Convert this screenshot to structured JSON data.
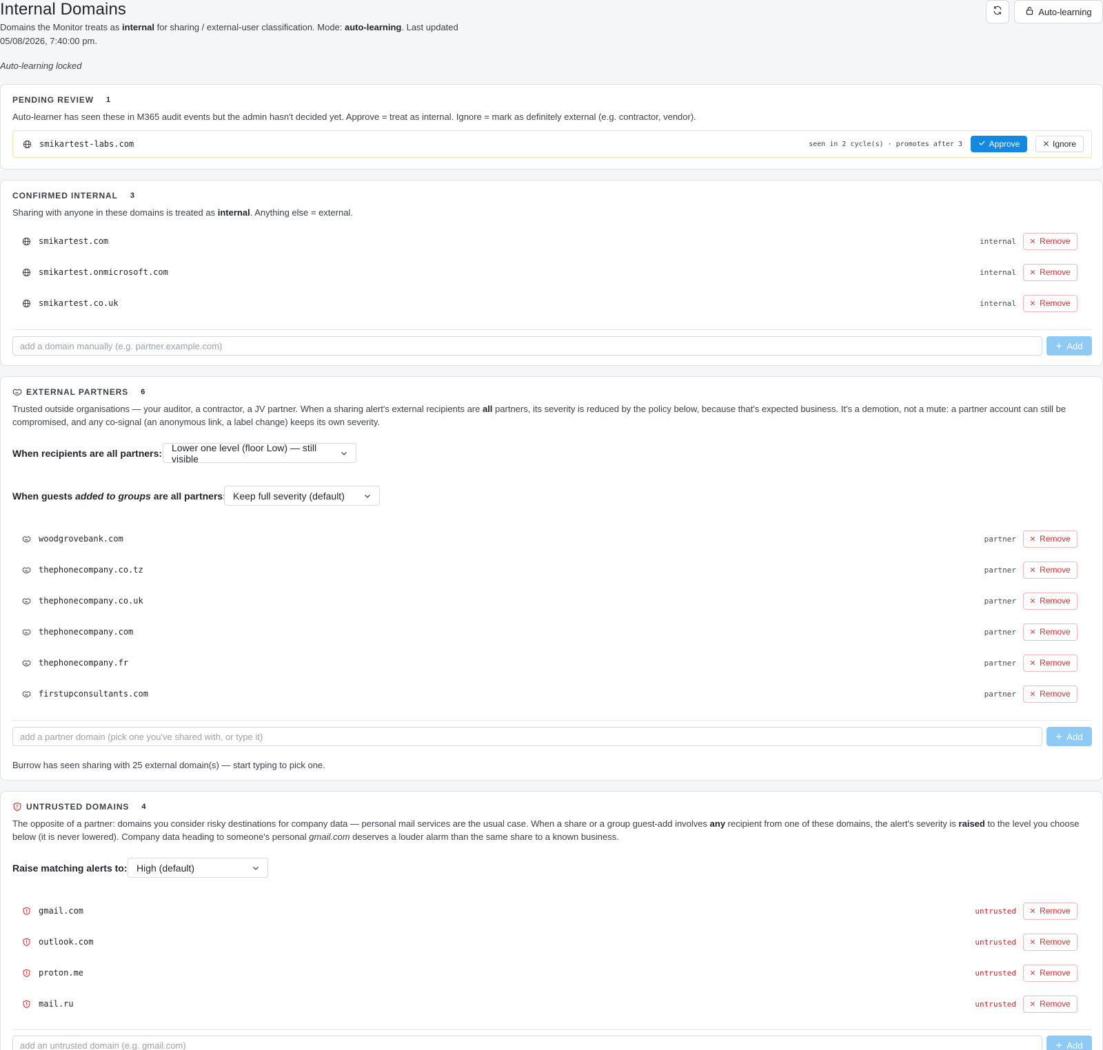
{
  "header": {
    "title": "Internal Domains",
    "subtitle_pre": "Domains the Monitor treats as ",
    "subtitle_bold1": "internal",
    "subtitle_mid": " for sharing / external-user classification. Mode: ",
    "subtitle_bold2": "auto-learning",
    "subtitle_post": ". Last updated 05/08/2026, 7:40:00 pm.",
    "locked_note": "Auto-learning locked",
    "auto_learning_label": "Auto-learning"
  },
  "pending": {
    "heading": "PENDING REVIEW",
    "count": "1",
    "description": "Auto-learner has seen these in M365 audit events but the admin hasn't decided yet. Approve = treat as internal. Ignore = mark as definitely external (e.g. contractor, vendor).",
    "items": [
      {
        "domain": "smikartest-labs.com",
        "meta": "seen in 2 cycle(s) · promotes after 3"
      }
    ],
    "approve_label": "Approve",
    "ignore_label": "Ignore"
  },
  "confirmed": {
    "heading": "CONFIRMED INTERNAL",
    "count": "3",
    "desc_pre": "Sharing with anyone in these domains is treated as ",
    "desc_bold": "internal",
    "desc_post": ". Anything else = external.",
    "items": [
      {
        "domain": "smikartest.com",
        "tag": "internal"
      },
      {
        "domain": "smikartest.onmicrosoft.com",
        "tag": "internal"
      },
      {
        "domain": "smikartest.co.uk",
        "tag": "internal"
      }
    ],
    "remove_label": "Remove",
    "add_placeholder": "add a domain manually (e.g. partner.example.com)",
    "add_label": "Add"
  },
  "partners": {
    "heading": "EXTERNAL PARTNERS",
    "count": "6",
    "desc_pre": "Trusted outside organisations — your auditor, a contractor, a JV partner. When a sharing alert's external recipients are ",
    "desc_bold": "all",
    "desc_post": " partners, its severity is reduced by the policy below, because that's expected business. It's a demotion, not a mute: a partner account can still be compromised, and any co-signal (an anonymous link, a label change) keeps its own severity.",
    "recipients_label": "When recipients are all partners:",
    "recipients_value": "Lower one level (floor Low) — still visible",
    "groups_label_pre": "When guests",
    "groups_label_em": "added to groups",
    "groups_label_post": "are all partners:",
    "groups_value": "Keep full severity (default)",
    "items": [
      {
        "domain": "woodgrovebank.com",
        "tag": "partner"
      },
      {
        "domain": "thephonecompany.co.tz",
        "tag": "partner"
      },
      {
        "domain": "thephonecompany.co.uk",
        "tag": "partner"
      },
      {
        "domain": "thephonecompany.com",
        "tag": "partner"
      },
      {
        "domain": "thephonecompany.fr",
        "tag": "partner"
      },
      {
        "domain": "firstupconsultants.com",
        "tag": "partner"
      }
    ],
    "remove_label": "Remove",
    "add_placeholder": "add a partner domain (pick one you've shared with, or type it)",
    "add_label": "Add",
    "footnote": "Burrow has seen sharing with 25 external domain(s) — start typing to pick one."
  },
  "untrusted": {
    "heading": "UNTRUSTED DOMAINS",
    "count": "4",
    "desc_pre": "The opposite of a partner: domains you consider risky destinations for company data — personal mail services are the usual case. When a share or a group guest-add involves ",
    "desc_bold1": "any",
    "desc_mid": " recipient from one of these domains, the alert's severity is ",
    "desc_bold2": "raised",
    "desc_mid2": " to the level you choose below (it is never lowered). Company data heading to someone's personal ",
    "desc_em": "gmail.com",
    "desc_post": " deserves a louder alarm than the same share to a known business.",
    "raise_label": "Raise matching alerts to:",
    "raise_value": "High (default)",
    "items": [
      {
        "domain": "gmail.com",
        "tag": "untrusted"
      },
      {
        "domain": "outlook.com",
        "tag": "untrusted"
      },
      {
        "domain": "proton.me",
        "tag": "untrusted"
      },
      {
        "domain": "mail.ru",
        "tag": "untrusted"
      }
    ],
    "remove_label": "Remove",
    "add_placeholder": "add an untrusted domain (e.g. gmail.com)",
    "add_label": "Add"
  },
  "icons": {
    "refresh": "refresh-icon",
    "lock": "lock-icon",
    "globe": "globe-icon",
    "handshake": "handshake-icon",
    "shield": "shield-alert-icon",
    "check": "check-icon",
    "close": "close-icon",
    "plus": "plus-icon",
    "chevron": "chevron-down-icon"
  },
  "colors": {
    "primary": "#1589e0",
    "add_button": "#8ecaf3",
    "danger": "#d0312d",
    "background": "#f5f6f8"
  }
}
